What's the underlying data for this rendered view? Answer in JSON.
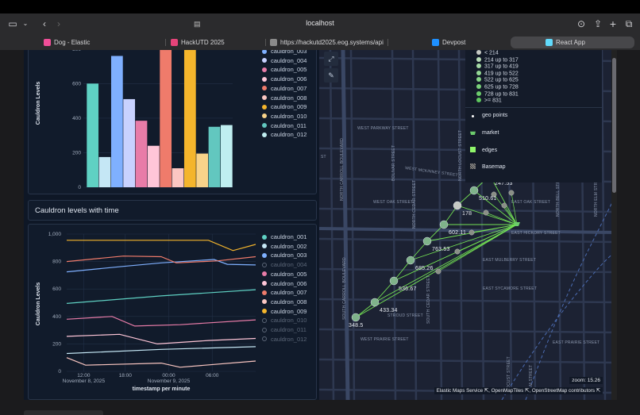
{
  "browser": {
    "address": "localhost",
    "tabs": [
      {
        "label": "Dog - Elastic",
        "color": "#f04e98"
      },
      {
        "label": "HackUTD 2025",
        "color": "#e6447a"
      },
      {
        "label": "https://hackutd2025.eog.systems/api/...",
        "color": "#8a8a8a"
      },
      {
        "label": "Devpost",
        "color": "#1e90ff"
      },
      {
        "label": "React App",
        "color": "#61dafb"
      }
    ]
  },
  "bar_panel": {
    "legend": [
      {
        "label": "cauldron_003",
        "color": "#7fb0ff",
        "on": true
      },
      {
        "label": "cauldron_004",
        "color": "#c8d2ff",
        "on": true
      },
      {
        "label": "cauldron_005",
        "color": "#e87ca8",
        "on": true
      },
      {
        "label": "cauldron_006",
        "color": "#ffc6d8",
        "on": true
      },
      {
        "label": "cauldron_007",
        "color": "#ef7b6b",
        "on": true
      },
      {
        "label": "cauldron_008",
        "color": "#fbc7c2",
        "on": true
      },
      {
        "label": "cauldron_009",
        "color": "#f4b52c",
        "on": true
      },
      {
        "label": "cauldron_010",
        "color": "#f8d38a",
        "on": true
      },
      {
        "label": "cauldron_011",
        "color": "#62c7bf",
        "on": true
      },
      {
        "label": "cauldron_012",
        "color": "#bfeef0",
        "on": true
      }
    ]
  },
  "line_panel": {
    "title": "Cauldron levels with time",
    "legend": [
      {
        "label": "cauldron_001",
        "color": "#5fd1c3",
        "on": true
      },
      {
        "label": "cauldron_002",
        "color": "#c5e7f5",
        "on": true
      },
      {
        "label": "cauldron_003",
        "color": "#7fb0ff",
        "on": true
      },
      {
        "label": "cauldron_004",
        "color": "#9aa5b6",
        "on": false
      },
      {
        "label": "cauldron_005",
        "color": "#e87ca8",
        "on": true
      },
      {
        "label": "cauldron_006",
        "color": "#ffc6d8",
        "on": true
      },
      {
        "label": "cauldron_007",
        "color": "#ef7b6b",
        "on": true
      },
      {
        "label": "cauldron_008",
        "color": "#fbc7c2",
        "on": true
      },
      {
        "label": "cauldron_009",
        "color": "#f4b52c",
        "on": true
      },
      {
        "label": "cauldron_010",
        "color": "#9aa5b6",
        "on": false
      },
      {
        "label": "cauldron_011",
        "color": "#9aa5b6",
        "on": false
      },
      {
        "label": "cauldron_012",
        "color": "#9aa5b6",
        "on": false
      }
    ]
  },
  "chart_data": [
    {
      "type": "bar",
      "ylabel": "Cauldron Levels",
      "ylim": [
        0,
        900
      ],
      "yticks": [
        "0",
        "200",
        "400",
        "600",
        "800"
      ],
      "categories": [
        "cauldron_001",
        "cauldron_002",
        "cauldron_003",
        "cauldron_004",
        "cauldron_005",
        "cauldron_006",
        "cauldron_007",
        "cauldron_008",
        "cauldron_009",
        "cauldron_010",
        "cauldron_011",
        "cauldron_012"
      ],
      "values": [
        600,
        175,
        760,
        510,
        385,
        240,
        840,
        110,
        880,
        195,
        350,
        360
      ],
      "colors": [
        "#5fd1c3",
        "#c5e7f5",
        "#7fb0ff",
        "#c8d2ff",
        "#e87ca8",
        "#ffc6d8",
        "#ef7b6b",
        "#fbc7c2",
        "#f4b52c",
        "#f8d38a",
        "#62c7bf",
        "#bfeef0"
      ]
    },
    {
      "type": "line",
      "ylabel": "Cauldron Levels",
      "xlabel": "timestamp per minute",
      "ylim": [
        0,
        1000
      ],
      "yticks": [
        "0",
        "200",
        "400",
        "600",
        "800",
        "1,000"
      ],
      "xticks": [
        {
          "t": 0.09,
          "label": "12:00",
          "sub": "November 8, 2025"
        },
        {
          "t": 0.31,
          "label": "18:00",
          "sub": ""
        },
        {
          "t": 0.54,
          "label": "00:00",
          "sub": "November 9, 2025"
        },
        {
          "t": 0.77,
          "label": "06:00",
          "sub": ""
        }
      ],
      "series": [
        {
          "name": "cauldron_001",
          "color": "#5fd1c3",
          "points": [
            [
              0,
              495
            ],
            [
              0.5,
              550
            ],
            [
              1,
              595
            ]
          ]
        },
        {
          "name": "cauldron_002",
          "color": "#c5e7f5",
          "points": [
            [
              0,
              130
            ],
            [
              0.5,
              160
            ],
            [
              1,
              180
            ]
          ]
        },
        {
          "name": "cauldron_003",
          "color": "#7fb0ff",
          "points": [
            [
              0,
              725
            ],
            [
              0.3,
              765
            ],
            [
              0.5,
              790
            ],
            [
              0.78,
              815
            ],
            [
              0.85,
              780
            ],
            [
              1,
              775
            ]
          ]
        },
        {
          "name": "cauldron_005",
          "color": "#e87ca8",
          "points": [
            [
              0,
              380
            ],
            [
              0.24,
              400
            ],
            [
              0.36,
              330
            ],
            [
              0.6,
              340
            ],
            [
              1,
              375
            ]
          ]
        },
        {
          "name": "cauldron_006",
          "color": "#ffc6d8",
          "points": [
            [
              0,
              255
            ],
            [
              0.28,
              270
            ],
            [
              0.48,
              200
            ],
            [
              0.75,
              225
            ],
            [
              1,
              240
            ]
          ]
        },
        {
          "name": "cauldron_007",
          "color": "#ef7b6b",
          "points": [
            [
              0,
              800
            ],
            [
              0.3,
              840
            ],
            [
              0.5,
              835
            ],
            [
              0.58,
              790
            ],
            [
              0.8,
              805
            ],
            [
              1,
              835
            ]
          ]
        },
        {
          "name": "cauldron_008",
          "color": "#fbc7c2",
          "points": [
            [
              0,
              100
            ],
            [
              0.1,
              45
            ],
            [
              0.5,
              60
            ],
            [
              0.6,
              30
            ],
            [
              1,
              75
            ]
          ]
        },
        {
          "name": "cauldron_009",
          "color": "#f4b52c",
          "points": [
            [
              0,
              955
            ],
            [
              0.75,
              955
            ],
            [
              0.88,
              880
            ],
            [
              1,
              925
            ]
          ]
        }
      ]
    }
  ],
  "map": {
    "streets": [
      "WEST PARKWAY STREET",
      "WEST MCKINNEY STREET",
      "WEST OAK STREET",
      "EAST OAK STREET",
      "EAST HICKORY STREET",
      "EAST MULBERRY STREET",
      "EAST SYCAMORE STREET",
      "STROUD STREET",
      "WEST PRAIRIE STREET",
      "EAST PRAIRIE STREET",
      "NORTH CARROLL BOULEVARD",
      "BOLIVAR STREET",
      "NORTH CEDAR STREET",
      "NORTH LOCUST STREET",
      "NORTH ELM STREET",
      "SOUTH CARROLL BOULEVARD",
      "SOUTH CEDAR STREET",
      "NORTH BELL STREET",
      "ELM STREET",
      "LOCUST STREET",
      "ST"
    ],
    "node_labels": [
      "348.5",
      "433.34",
      "536.67",
      "685.26",
      "763.53",
      "602.11",
      "178",
      "510.61",
      "247.53"
    ],
    "legend_ranges": [
      {
        "label": "< 214",
        "color": "#c6c9c4"
      },
      {
        "label": "214 up to 317",
        "color": "#b8dcb7"
      },
      {
        "label": "317 up to 419",
        "color": "#a5dba5"
      },
      {
        "label": "419 up to 522",
        "color": "#94d894"
      },
      {
        "label": "522 up to 625",
        "color": "#86d586"
      },
      {
        "label": "625 up to 728",
        "color": "#79d179"
      },
      {
        "label": "728 up to 831",
        "color": "#6ccc6c"
      },
      {
        "label": ">= 831",
        "color": "#5ec75e"
      }
    ],
    "layers": [
      "geo points",
      "market",
      "edges",
      "Basemap"
    ],
    "zoom": "zoom: 15.26",
    "attribution": "Elastic Maps Service ⇱, OpenMapTiles ⇱, OpenStreetMap contributors ⇱"
  }
}
